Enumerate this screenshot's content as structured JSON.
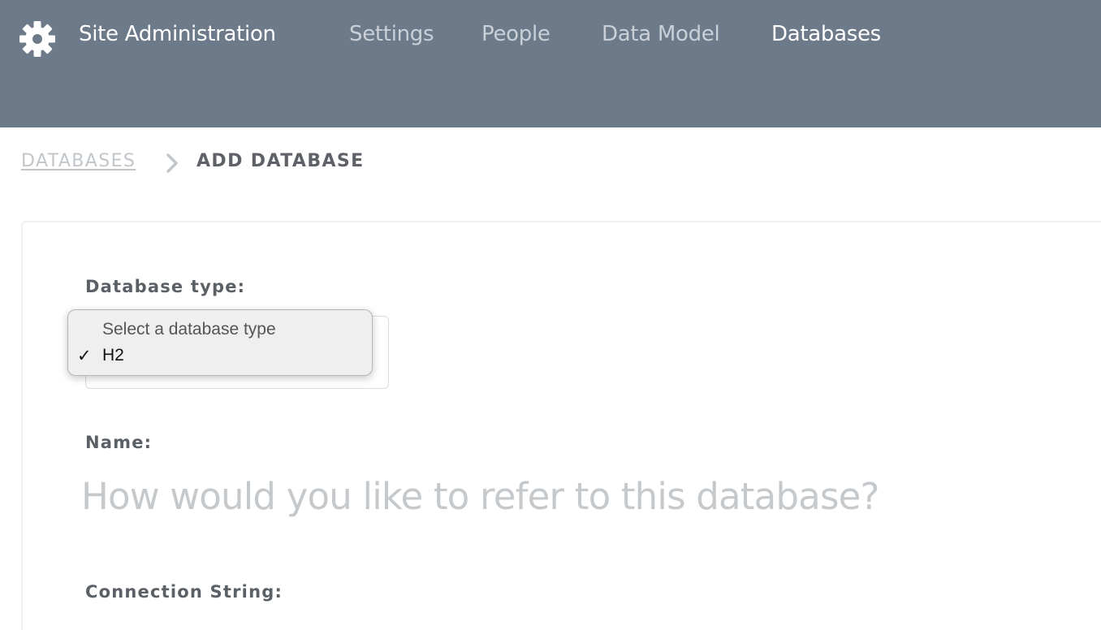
{
  "header": {
    "app_icon": "gear-icon",
    "title": "Site Administration",
    "nav": [
      {
        "label": "Settings",
        "active": false
      },
      {
        "label": "People",
        "active": false
      },
      {
        "label": "Data Model",
        "active": false
      },
      {
        "label": "Databases",
        "active": true
      }
    ]
  },
  "breadcrumb": {
    "parent": "DATABASES",
    "separator_icon": "chevron-right-icon",
    "current": "ADD DATABASE"
  },
  "form": {
    "database_type_label": "Database type:",
    "database_type_dropdown": {
      "options": [
        {
          "label": "Select a database type",
          "selected": false
        },
        {
          "label": "H2",
          "selected": true
        }
      ],
      "checkmark": "✓"
    },
    "name_label": "Name:",
    "name_placeholder": "How would you like to refer to this database?",
    "name_value": "",
    "connection_string_label": "Connection String:"
  },
  "colors": {
    "header_bg": "#6d7a8a",
    "nav_inactive": "#c9d0d8",
    "nav_active": "#ffffff"
  }
}
